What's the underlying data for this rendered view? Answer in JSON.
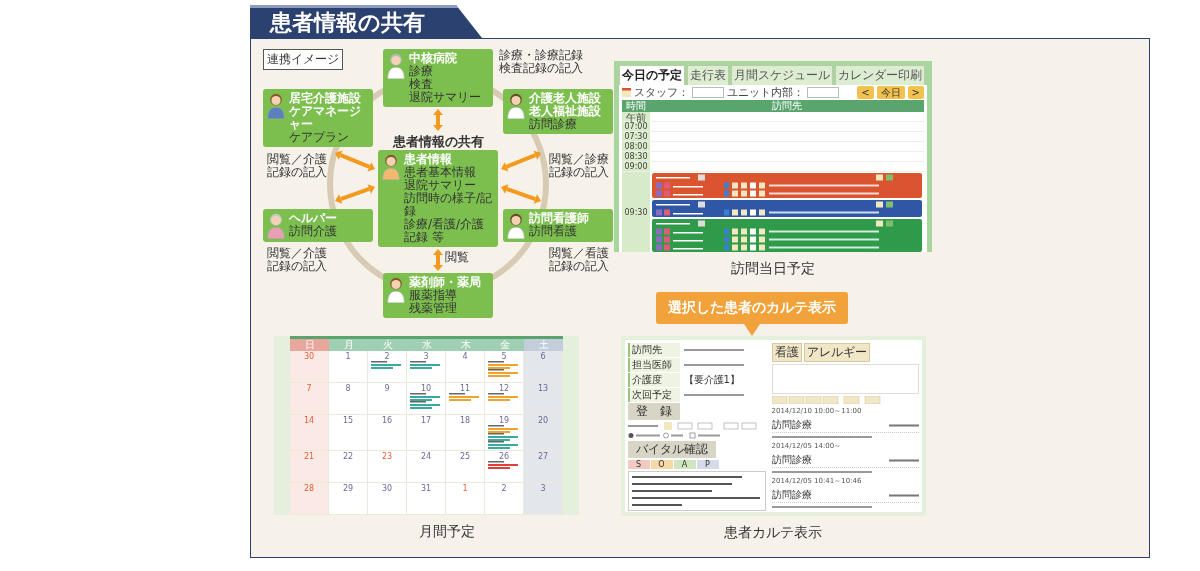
{
  "header": {
    "title": "患者情報の共有"
  },
  "diagram": {
    "label": "連携イメージ",
    "title": "患者情報の共有",
    "nodes": [
      {
        "title": [
          "中核病院"
        ],
        "lines": [
          "診療",
          "検査",
          "退院サマリー"
        ]
      },
      {
        "title": [
          "居宅介護施設",
          "ケアマネージャー"
        ],
        "lines": [
          "ケアプラン"
        ]
      },
      {
        "title": [
          "介護老人施設",
          "老人福祉施設"
        ],
        "lines": [
          "訪問診療"
        ]
      },
      {
        "title": [
          "ヘルパー"
        ],
        "lines": [
          "訪問介護"
        ]
      },
      {
        "title": [
          "患者情報"
        ],
        "lines": [
          "患者基本情報",
          "退院サマリー",
          "訪問時の様子/記録",
          "診療/看護/介護記録 等"
        ]
      },
      {
        "title": [
          "訪問看護師"
        ],
        "lines": [
          "訪問看護"
        ]
      },
      {
        "title": [
          "薬剤師・薬局"
        ],
        "lines": [
          "服薬指導",
          "残薬管理"
        ]
      }
    ],
    "links": [
      {
        "lines": [
          "診療・診療記録",
          "検査記録の記入"
        ]
      },
      {
        "lines": [
          "閲覧／介護",
          "記録の記入"
        ]
      },
      {
        "lines": [
          "閲覧／診療",
          "記録の記入"
        ]
      },
      {
        "lines": [
          "閲覧／介護",
          "記録の記入"
        ]
      },
      {
        "lines": [
          "閲覧"
        ]
      },
      {
        "lines": [
          "閲覧／看護",
          "記録の記入"
        ]
      }
    ]
  },
  "schedule": {
    "caption": "訪問当日予定",
    "tabs": [
      {
        "label": "今日の予定",
        "selected": true
      },
      {
        "label": "走行表",
        "selected": false
      },
      {
        "label": "月間スケジュール",
        "selected": false
      },
      {
        "label": "カレンダー印刷",
        "selected": false
      }
    ],
    "filters": [
      "スタッフ：",
      "ユニット内部："
    ],
    "buttons": [
      "<",
      "今日",
      ">"
    ],
    "columns": [
      "時間",
      "訪問先"
    ],
    "times": [
      "午前",
      "07:00",
      "07:30",
      "08:00",
      "08:30",
      "09:00"
    ],
    "block_time": "09:30",
    "groups": [
      {
        "color": "#d9542f",
        "visits": [
          {
            "kind": "visit"
          },
          {
            "kind": "visit"
          }
        ]
      },
      {
        "color": "#2f57a6",
        "visits": [
          {
            "kind": "visit"
          }
        ]
      },
      {
        "color": "#2e9a4a",
        "visits": [
          {
            "kind": "visit"
          },
          {
            "kind": "visit"
          },
          {
            "kind": "visit"
          }
        ]
      }
    ]
  },
  "calendar": {
    "caption": "月間予定",
    "weekdays": [
      "日",
      "月",
      "火",
      "水",
      "木",
      "金",
      "土"
    ],
    "weeks": [
      [
        {
          "day": "30",
          "holiday": true
        },
        {
          "day": "1",
          "holiday": false
        },
        {
          "day": "2",
          "holiday": false,
          "entries": [
            {
              "color": "#3aa9a0"
            }
          ]
        },
        {
          "day": "3",
          "holiday": false,
          "entries": [
            {
              "color": "#3aa9a0"
            }
          ]
        },
        {
          "day": "4",
          "holiday": false
        },
        {
          "day": "5",
          "holiday": false,
          "entries": [
            {
              "color": "#f0a22e"
            },
            {
              "color": "#f0a22e"
            }
          ]
        },
        {
          "day": "6",
          "holiday": false
        }
      ],
      [
        {
          "day": "7",
          "holiday": true
        },
        {
          "day": "8",
          "holiday": false
        },
        {
          "day": "9",
          "holiday": false
        },
        {
          "day": "10",
          "holiday": false,
          "entries": [
            {
              "color": "#3aa9a0"
            },
            {
              "color": "#3aa9a0"
            }
          ]
        },
        {
          "day": "11",
          "holiday": false,
          "entries": [
            {
              "color": "#f0a22e"
            }
          ]
        },
        {
          "day": "12",
          "holiday": false,
          "entries": [
            {
              "color": "#f0a22e"
            }
          ]
        },
        {
          "day": "13",
          "holiday": false
        }
      ],
      [
        {
          "day": "14",
          "holiday": true
        },
        {
          "day": "15",
          "holiday": false
        },
        {
          "day": "16",
          "holiday": false
        },
        {
          "day": "17",
          "holiday": false
        },
        {
          "day": "18",
          "holiday": false
        },
        {
          "day": "19",
          "holiday": false,
          "entries": [
            {
              "color": "#f0a22e"
            },
            {
              "color": "#3aa9a0"
            },
            {
              "color": "#3aa9a0"
            }
          ]
        },
        {
          "day": "20",
          "holiday": false
        }
      ],
      [
        {
          "day": "21",
          "holiday": true
        },
        {
          "day": "22",
          "holiday": false
        },
        {
          "day": "23",
          "holiday": true
        },
        {
          "day": "24",
          "holiday": false
        },
        {
          "day": "25",
          "holiday": false
        },
        {
          "day": "26",
          "holiday": false,
          "entries": [
            {
              "color": "#e0403a"
            }
          ]
        },
        {
          "day": "27",
          "holiday": false
        }
      ],
      [
        {
          "day": "28",
          "holiday": true
        },
        {
          "day": "29",
          "holiday": false
        },
        {
          "day": "30",
          "holiday": false
        },
        {
          "day": "31",
          "holiday": false
        },
        {
          "day": "1",
          "holiday": true
        },
        {
          "day": "2",
          "holiday": false
        },
        {
          "day": "3",
          "holiday": false
        }
      ]
    ]
  },
  "karte": {
    "caption": "患者カルテ表示",
    "fields": [
      {
        "label": "訪問先"
      },
      {
        "label": "担当医師"
      },
      {
        "label": "介護度",
        "value": "【要介護1】"
      },
      {
        "label": "次回予定"
      }
    ],
    "register": "登　録",
    "vital": "バイタル確認",
    "soap": [
      {
        "label": "S",
        "color": "#f3c9c2"
      },
      {
        "label": "O",
        "color": "#f7d9a8"
      },
      {
        "label": "A",
        "color": "#cfe5bf"
      },
      {
        "label": "P",
        "color": "#d5dbea"
      }
    ],
    "side_tabs": [
      "看護",
      "アレルギー"
    ],
    "records": [
      {
        "date": "2014/12/10 10:00～11:00",
        "title": "訪問診療"
      },
      {
        "date": "2014/12/05 14:00～",
        "title": "訪問診療"
      },
      {
        "date": "2014/12/05 10:41～10:46",
        "title": "訪問診療"
      }
    ]
  },
  "callout": {
    "text": "選択した患者のカルテ表示"
  }
}
